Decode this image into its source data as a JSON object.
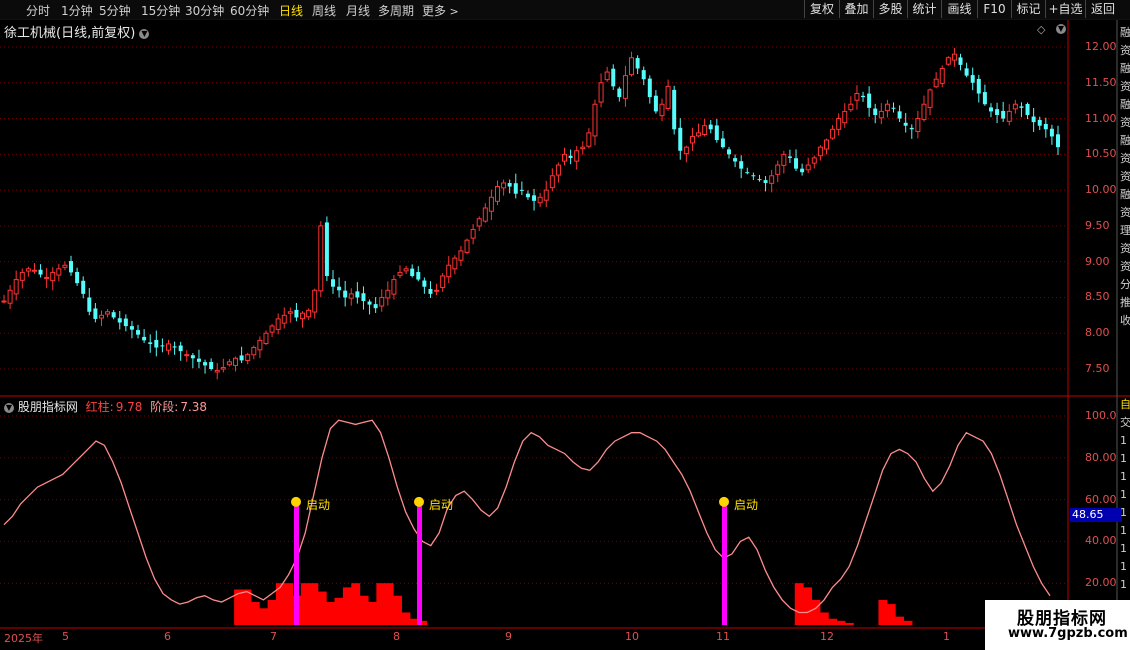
{
  "toolbar": {
    "timeframes": [
      "分时",
      "1分钟",
      "5分钟",
      "15分钟",
      "30分钟",
      "60分钟",
      "日线",
      "周线",
      "月线",
      "多周期",
      "更多"
    ],
    "active": "日线",
    "more_arrow": ">",
    "right_buttons": [
      "复权",
      "叠加",
      "多股",
      "统计",
      "画线",
      "F10",
      "标记",
      "+自选",
      "返回"
    ]
  },
  "main_chart": {
    "title": "徐工机械(日线,前复权)",
    "expand_icon": "chevron-down-icon",
    "diamond_icon": "◇",
    "y_ticks": [
      "12.00",
      "11.50",
      "11.00",
      "10.50",
      "10.00",
      "9.50",
      "9.00",
      "8.50",
      "8.00",
      "7.50"
    ]
  },
  "indicator": {
    "name": "股朋指标网",
    "red_label": "红柱:",
    "red_value": "9.78",
    "stage_label": "阶段:",
    "stage_value": "7.38",
    "y_ticks": [
      "100.0",
      "80.00",
      "60.00",
      "40.00",
      "20.00"
    ],
    "current_value": "48.65",
    "signal_label": "启动"
  },
  "x_axis": {
    "labels": [
      "2025年",
      "5",
      "6",
      "7",
      "8",
      "9",
      "10",
      "11",
      "12",
      "1"
    ]
  },
  "right_panel": {
    "top_chars": [
      "融",
      "资",
      "融",
      "资",
      "融",
      "资",
      "融",
      "资",
      "资",
      "融",
      "资",
      "理",
      "资",
      "资",
      "分",
      "推",
      "收"
    ],
    "bottom_chars": [
      "自",
      "交",
      "1",
      "1",
      "1",
      "1",
      "1",
      "1",
      "1",
      "1",
      "1"
    ]
  },
  "watermark": {
    "line1": "股朋指标网",
    "line2": "www.7gpzb.com"
  },
  "colors": {
    "up": "#ff3333",
    "down": "#54fcfc",
    "line": "#ff8c8c",
    "bar": "#ff0000",
    "signal": "#ff00ff",
    "axis": "#c00000",
    "grid": "#7a0000",
    "accent": "#ffe000"
  },
  "chart_data": [
    {
      "type": "candlestick",
      "title": "徐工机械(日线,前复权)",
      "x_labels": [
        "2025年",
        "5",
        "6",
        "7",
        "8",
        "9",
        "10",
        "11",
        "12",
        "1"
      ],
      "ylim": [
        7.3,
        12.1
      ],
      "y_ticks": [
        7.5,
        8.0,
        8.5,
        9.0,
        9.5,
        10.0,
        10.5,
        11.0,
        11.5,
        12.0
      ],
      "close_path": [
        8.45,
        8.6,
        8.75,
        8.85,
        8.9,
        8.88,
        8.82,
        8.78,
        8.85,
        8.9,
        8.95,
        8.85,
        8.7,
        8.55,
        8.3,
        8.2,
        8.25,
        8.3,
        8.22,
        8.15,
        8.1,
        8.05,
        7.98,
        7.9,
        7.85,
        7.8,
        7.82,
        7.85,
        7.8,
        7.75,
        7.7,
        7.65,
        7.6,
        7.55,
        7.5,
        7.48,
        7.52,
        7.6,
        7.65,
        7.62,
        7.7,
        7.8,
        7.9,
        8.0,
        8.1,
        8.2,
        8.25,
        8.3,
        8.22,
        8.28,
        8.32,
        8.6,
        9.5,
        8.8,
        8.65,
        8.6,
        8.5,
        8.55,
        8.5,
        8.45,
        8.4,
        8.35,
        8.5,
        8.6,
        8.75,
        8.85,
        8.9,
        8.8,
        8.75,
        8.65,
        8.55,
        8.6,
        8.8,
        8.95,
        9.05,
        9.15,
        9.3,
        9.45,
        9.6,
        9.75,
        9.9,
        10.05,
        10.1,
        10.05,
        9.95,
        10.0,
        9.9,
        9.85,
        9.9,
        10.0,
        10.2,
        10.35,
        10.5,
        10.45,
        10.55,
        10.6,
        10.8,
        11.2,
        11.5,
        11.65,
        11.45,
        11.3,
        11.6,
        11.85,
        11.7,
        11.55,
        11.3,
        11.1,
        11.2,
        11.45,
        10.85,
        10.55,
        10.6,
        10.75,
        10.8,
        10.9,
        10.85,
        10.7,
        10.6,
        10.5,
        10.4,
        10.3,
        10.25,
        10.2,
        10.15,
        10.1,
        10.2,
        10.35,
        10.5,
        10.45,
        10.3,
        10.25,
        10.35,
        10.45,
        10.6,
        10.7,
        10.85,
        11.0,
        11.1,
        11.2,
        11.35,
        11.3,
        11.15,
        11.05,
        11.1,
        11.2,
        11.15,
        11.0,
        10.9,
        10.85,
        11.0,
        11.2,
        11.4,
        11.55,
        11.7,
        11.85,
        11.9,
        11.75,
        11.6,
        11.5,
        11.35,
        11.2,
        11.1,
        11.05,
        11.0,
        11.1,
        11.2,
        11.15,
        11.05,
        10.95,
        10.9,
        10.85,
        10.75,
        10.6
      ]
    },
    {
      "type": "line+bar",
      "title": "股朋指标网",
      "ylim": [
        0,
        105
      ],
      "y_ticks": [
        20,
        40,
        60,
        80,
        100
      ],
      "series": [
        {
          "name": "阶段",
          "values": [
            48,
            52,
            58,
            62,
            66,
            68,
            70,
            72,
            76,
            80,
            84,
            88,
            86,
            78,
            68,
            56,
            44,
            32,
            22,
            15,
            12,
            10,
            11,
            13,
            14,
            12,
            11,
            13,
            15,
            16,
            14,
            12,
            15,
            18,
            24,
            32,
            44,
            62,
            80,
            94,
            98,
            97,
            96,
            97,
            98,
            92,
            80,
            66,
            54,
            46,
            40,
            38,
            44,
            56,
            62,
            64,
            60,
            55,
            52,
            56,
            66,
            78,
            88,
            92,
            90,
            86,
            84,
            82,
            78,
            75,
            74,
            78,
            84,
            88,
            90,
            92,
            92,
            90,
            88,
            84,
            78,
            72,
            64,
            54,
            44,
            36,
            32,
            34,
            40,
            42,
            36,
            26,
            18,
            12,
            8,
            6,
            6,
            8,
            12,
            18,
            22,
            28,
            38,
            50,
            62,
            74,
            82,
            84,
            82,
            78,
            70,
            64,
            68,
            76,
            86,
            92,
            90,
            88,
            82,
            72,
            60,
            48,
            38,
            28,
            20,
            14
          ]
        },
        {
          "name": "红柱",
          "values": [
            0,
            0,
            0,
            0,
            0,
            0,
            0,
            0,
            0,
            0,
            0,
            0,
            0,
            0,
            0,
            0,
            0,
            0,
            0,
            0,
            0,
            0,
            0,
            0,
            0,
            0,
            0,
            0,
            17,
            17,
            11,
            8,
            12,
            20,
            20,
            14,
            20,
            20,
            16,
            11,
            13,
            18,
            20,
            14,
            11,
            20,
            20,
            14,
            6,
            3,
            2,
            0,
            0,
            0,
            0,
            0,
            0,
            0,
            0,
            0,
            0,
            0,
            0,
            0,
            0,
            0,
            0,
            0,
            0,
            0,
            0,
            0,
            0,
            0,
            0,
            0,
            0,
            0,
            0,
            0,
            0,
            0,
            0,
            0,
            0,
            0,
            0,
            0,
            0,
            0,
            0,
            0,
            0,
            0,
            0,
            0,
            0,
            0,
            0,
            0,
            0,
            0,
            0,
            0,
            0,
            0,
            0,
            0,
            0,
            0,
            0,
            0,
            0,
            0,
            0,
            0,
            0,
            0,
            0,
            0,
            0,
            0,
            0,
            0,
            0,
            0
          ]
        }
      ],
      "signals": [
        {
          "label": "启动",
          "x": "7",
          "value": 57
        },
        {
          "label": "启动",
          "x": "8",
          "value": 57
        },
        {
          "label": "启动",
          "x": "11",
          "value": 57
        }
      ],
      "current_value": 48.65
    }
  ]
}
